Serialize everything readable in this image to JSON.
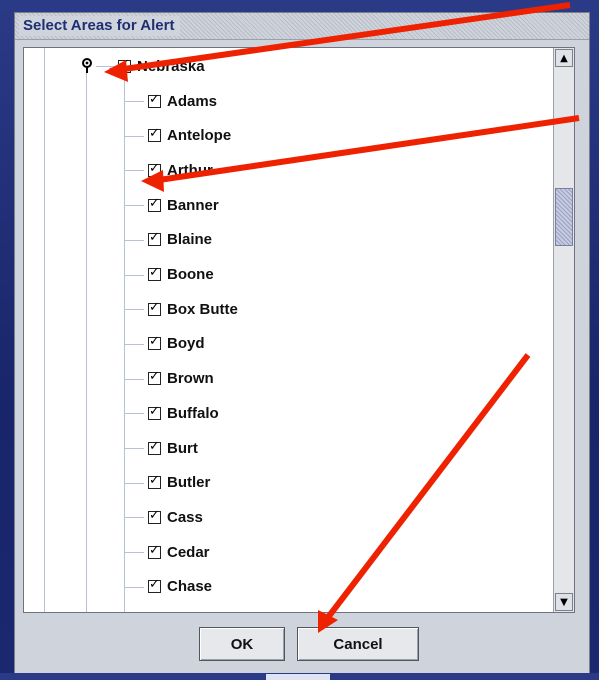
{
  "dialog": {
    "title": "Select Areas for Alert",
    "ok_label": "OK",
    "cancel_label": "Cancel"
  },
  "tree": {
    "root": {
      "label": "Nebraska",
      "checked": true
    },
    "children": [
      {
        "label": "Adams",
        "checked": true
      },
      {
        "label": "Antelope",
        "checked": true
      },
      {
        "label": "Arthur",
        "checked": true
      },
      {
        "label": "Banner",
        "checked": true
      },
      {
        "label": "Blaine",
        "checked": true
      },
      {
        "label": "Boone",
        "checked": true
      },
      {
        "label": "Box Butte",
        "checked": true
      },
      {
        "label": "Boyd",
        "checked": true
      },
      {
        "label": "Brown",
        "checked": true
      },
      {
        "label": "Buffalo",
        "checked": true
      },
      {
        "label": "Burt",
        "checked": true
      },
      {
        "label": "Butler",
        "checked": true
      },
      {
        "label": "Cass",
        "checked": true
      },
      {
        "label": "Cedar",
        "checked": true
      },
      {
        "label": "Chase",
        "checked": true
      }
    ]
  },
  "scrollbar": {
    "up_icon": "scroll-up-arrow-icon",
    "down_icon": "scroll-down-arrow-icon"
  },
  "colors": {
    "annotation_arrow": "#ee2200",
    "title_text": "#1f2f70",
    "background": "#1c2a6e"
  }
}
